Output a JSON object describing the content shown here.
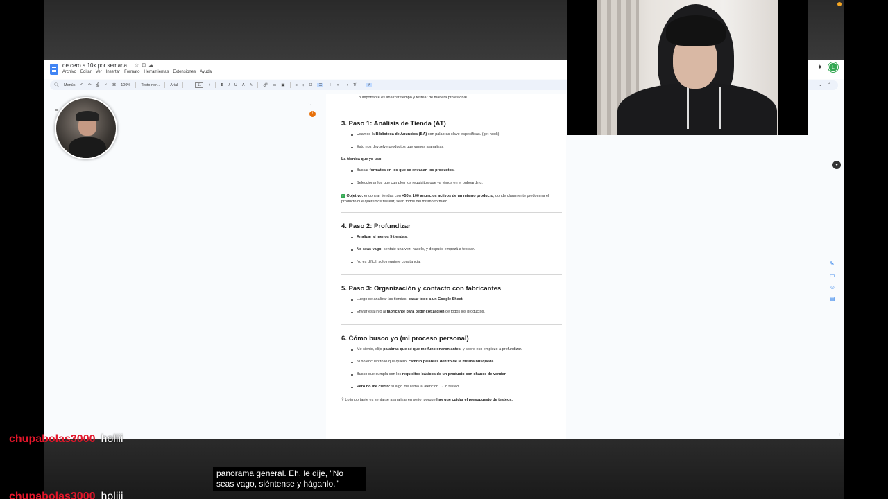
{
  "docs": {
    "title": "de cero a 10k por semana",
    "title_icons": [
      "☆",
      "⊡",
      "☁"
    ],
    "menu": [
      "Archivo",
      "Editar",
      "Ver",
      "Insertar",
      "Formato",
      "Herramientas",
      "Extensiones",
      "Ayuda"
    ],
    "account_initial": "L",
    "toolbar": {
      "search": "Menús",
      "zoom": "100%",
      "style": "Texto nor...",
      "font": "Arial",
      "font_size": "11"
    },
    "side_tab": "☰",
    "comment_count": "17",
    "content": {
      "cut_line": "Lo importante es analizar tiempo y testear de manera profesional.",
      "s3_title": "3. Paso 1: Análisis de Tienda (AT)",
      "s3_b1_pre": "Usamos la ",
      "s3_b1_bold": "Biblioteca de Anuncios (BA)",
      "s3_b1_post": " con palabras clave específicas. (get hook)",
      "s3_b2": "Esto nos devuelve productos que vamos a analizar.",
      "tech_label": "La técnica que yo uso:",
      "tech_b1_pre": "Buscar ",
      "tech_b1_bold": "formatos en los que se envasan los productos.",
      "tech_b2": "Seleccionar los que cumplen los requisitos que ya vimos en el onboarding.",
      "obj_label": "Objetivo:",
      "obj_pre": " encontrar tiendas con ",
      "obj_bold": "+50 a 100 anuncios activos de un mismo producto",
      "obj_post": ", donde claramente predomina el producto que queremos testear, sean todos del mismo formato",
      "s4_title": "4. Paso 2: Profundizar",
      "s4_b1": "Analizar al menos 5 tiendas.",
      "s4_b2_bold": "No seas vago:",
      "s4_b2_post": " sentate una vez, hacelo, y después empezá a testear.",
      "s4_b3": "No es difícil, solo requiere constancia.",
      "s5_title": "5. Paso 3: Organización y contacto con fabricantes",
      "s5_b1_pre": "Luego de analizar las tiendas, ",
      "s5_b1_bold": "pasar todo a un Google Sheet.",
      "s5_b2_pre": "Enviar esa info al ",
      "s5_b2_bold": "fabricante para pedir cotización",
      "s5_b2_post": " de todos los productos.",
      "s6_title": "6. Cómo busco yo (mi proceso personal)",
      "s6_b1_pre": "Me siento, elijo ",
      "s6_b1_bold": "palabras que sé que me funcionaron antes",
      "s6_b1_post": ", y sobre eso empiezo a profundizar.",
      "s6_b2_pre": "Si no encuentro lo que quiero, ",
      "s6_b2_bold": "cambio palabras dentro de la misma búsqueda.",
      "s6_b3_pre": "Busco que cumpla con los ",
      "s6_b3_bold": "requisitos básicos de un producto con chance de vender.",
      "s6_b4_bold": "Pero no me cierro:",
      "s6_b4_post": " si algo me llama la atención → lo testeo.",
      "last_line_pre": "Lo importante es sentarse a analizar en serio, porque ",
      "last_line_bold": "hay que cuidar el presupuesto de testeos."
    }
  },
  "chat": [
    {
      "user": "chupabolas3000",
      "message": "holiii"
    },
    {
      "user": "chupabolas3000",
      "message": "holiii"
    }
  ],
  "subtitle": "panorama general. Eh, le dije, \"No seas vago, siéntense y háganlo.\"",
  "colors": {
    "chat_user": "#e3162a",
    "docs_blue": "#4285f4",
    "account_green": "#34a853",
    "comment_orange": "#e8710a"
  }
}
